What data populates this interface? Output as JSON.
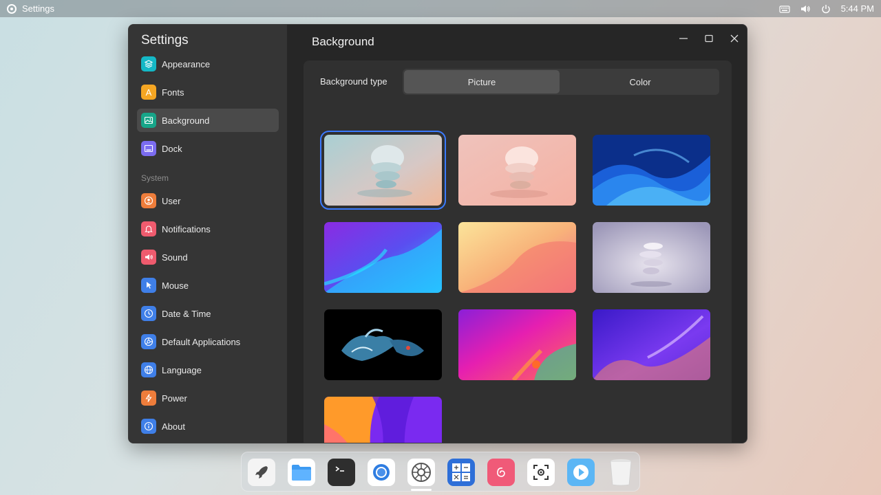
{
  "topbar": {
    "app_name": "Settings",
    "time": "5:44 PM",
    "icons": [
      "keyboard-icon",
      "volume-icon",
      "power-icon"
    ]
  },
  "window": {
    "sidebar_title": "Settings",
    "section_system": "System",
    "nav": [
      {
        "label": "Appearance",
        "icon": "layers-icon",
        "color": "#14b8c6"
      },
      {
        "label": "Fonts",
        "icon": "font-icon",
        "color": "#f5a623"
      },
      {
        "label": "Background",
        "icon": "image-icon",
        "color": "#17a589",
        "active": true
      },
      {
        "label": "Dock",
        "icon": "dock-icon",
        "color": "#7b6cf0"
      },
      {
        "label": "User",
        "icon": "user-icon",
        "color": "#ee7d3b"
      },
      {
        "label": "Notifications",
        "icon": "bell-icon",
        "color": "#ef5b6e"
      },
      {
        "label": "Sound",
        "icon": "speaker-icon",
        "color": "#ef5b6e"
      },
      {
        "label": "Mouse",
        "icon": "cursor-icon",
        "color": "#3f7fe8"
      },
      {
        "label": "Date & Time",
        "icon": "clock-icon",
        "color": "#3f7fe8"
      },
      {
        "label": "Default Applications",
        "icon": "apps-icon",
        "color": "#3f7fe8"
      },
      {
        "label": "Language",
        "icon": "globe-icon",
        "color": "#3f7fe8"
      },
      {
        "label": "Power",
        "icon": "bolt-icon",
        "color": "#ee7d3b"
      },
      {
        "label": "About",
        "icon": "info-icon",
        "color": "#3f7fe8"
      }
    ],
    "main_title": "Background",
    "background_type_label": "Background type",
    "segment": {
      "picture": "Picture",
      "color": "Color",
      "selected": "Picture"
    },
    "wallpapers": [
      {
        "name": "wallpaper-sculpture-teal",
        "selected": true
      },
      {
        "name": "wallpaper-sculpture-peach"
      },
      {
        "name": "wallpaper-blue-waves"
      },
      {
        "name": "wallpaper-purple-cyan"
      },
      {
        "name": "wallpaper-yellow-pink"
      },
      {
        "name": "wallpaper-sculpture-lavender"
      },
      {
        "name": "wallpaper-betta-fish"
      },
      {
        "name": "wallpaper-magenta-gradient"
      },
      {
        "name": "wallpaper-violet-flow"
      },
      {
        "name": "wallpaper-orange-violet"
      }
    ]
  },
  "dock": {
    "apps": [
      "launcher-icon",
      "files-icon",
      "terminal-icon",
      "browser-icon",
      "settings-icon",
      "calculator-icon",
      "debian-icon",
      "screenshot-icon",
      "video-icon",
      "trash-icon"
    ],
    "active": "settings-icon"
  }
}
